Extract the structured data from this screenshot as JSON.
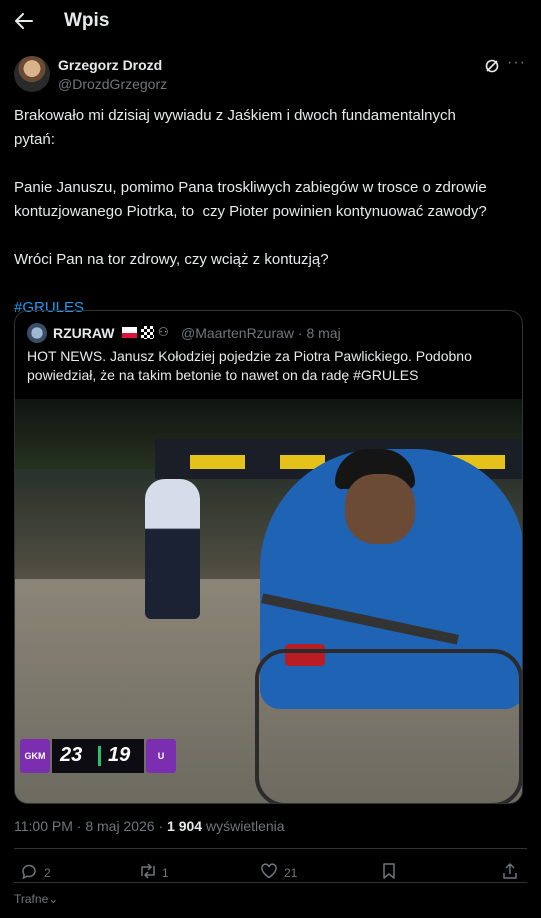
{
  "header": {
    "title": "Wpis"
  },
  "author": {
    "name": "Grzegorz Drozd",
    "handle": "@DrozdGrzegorz"
  },
  "tweet": {
    "p1": "Brakowało mi dzisiaj wywiadu z Jaśkiem i dwoch fundamentalnych\npytań:",
    "p2": "Panie Januszu, pomimo Pana troskliwych zabiegów w trosce o zdrowie\nkontuzjowanego Piotrka, to  czy Pioter powinien kontynuować zawody?",
    "p3": "Wróci Pan na tor zdrowy, czy wciąż z kontuzją?",
    "hashtag": "#GRULES"
  },
  "quote": {
    "name": "RZURAW",
    "meta": "@MaartenRzuraw · 8 maj",
    "text": "HOT NEWS. Janusz Kołodziej pojedzie za Piotra Pawlickiego. Podobno\npowiedział, że na takim betonie to nawet on da radę #GRULES",
    "media": {
      "score_home": "23",
      "score_away": "19",
      "logo_home": "GKM",
      "logo_away": "U",
      "accent": "#7b2fb0"
    }
  },
  "meta": {
    "time": "11:00 PM · 8 maj 2026 · ",
    "views": "1 904",
    "views_label": " wyświetlenia"
  },
  "actions": {
    "replies": "2",
    "reposts": "1",
    "likes": "21"
  },
  "sort": {
    "label": "Trafne"
  },
  "colors": {
    "background": "#000000",
    "text": "#e7e9ea",
    "muted": "#71767b",
    "link": "#1d9bf0",
    "border": "#2f3336"
  }
}
